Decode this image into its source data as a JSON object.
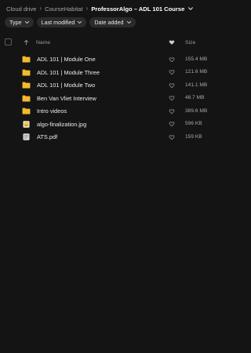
{
  "breadcrumb": {
    "items": [
      "Cloud drive",
      "CourseHabitat",
      "ProfessorAlgo – ADL 101 Course"
    ],
    "separator": "›"
  },
  "filters": [
    {
      "label": "Type"
    },
    {
      "label": "Last modified"
    },
    {
      "label": "Date added"
    }
  ],
  "table": {
    "headers": {
      "name": "Name",
      "size": "Size"
    },
    "rows": [
      {
        "name": "ADL 101 | Module One",
        "size": "155.4 MB",
        "type": "folder"
      },
      {
        "name": "ADL 101 | Module Three",
        "size": "121.6 MB",
        "type": "folder"
      },
      {
        "name": "ADL 101 | Module Two",
        "size": "141.1 MB",
        "type": "folder"
      },
      {
        "name": "Ben Van Vliet Interview",
        "size": "48.7 MB",
        "type": "folder"
      },
      {
        "name": "Intro videos",
        "size": "389.6 MB",
        "type": "folder"
      },
      {
        "name": "algo-finalization.jpg",
        "size": "596 KB",
        "type": "image"
      },
      {
        "name": "ATS.pdf",
        "size": "159 KB",
        "type": "pdf"
      }
    ]
  },
  "colors": {
    "background": "#141414",
    "chip": "#2b2b2b",
    "folder": "#f5b82e"
  }
}
